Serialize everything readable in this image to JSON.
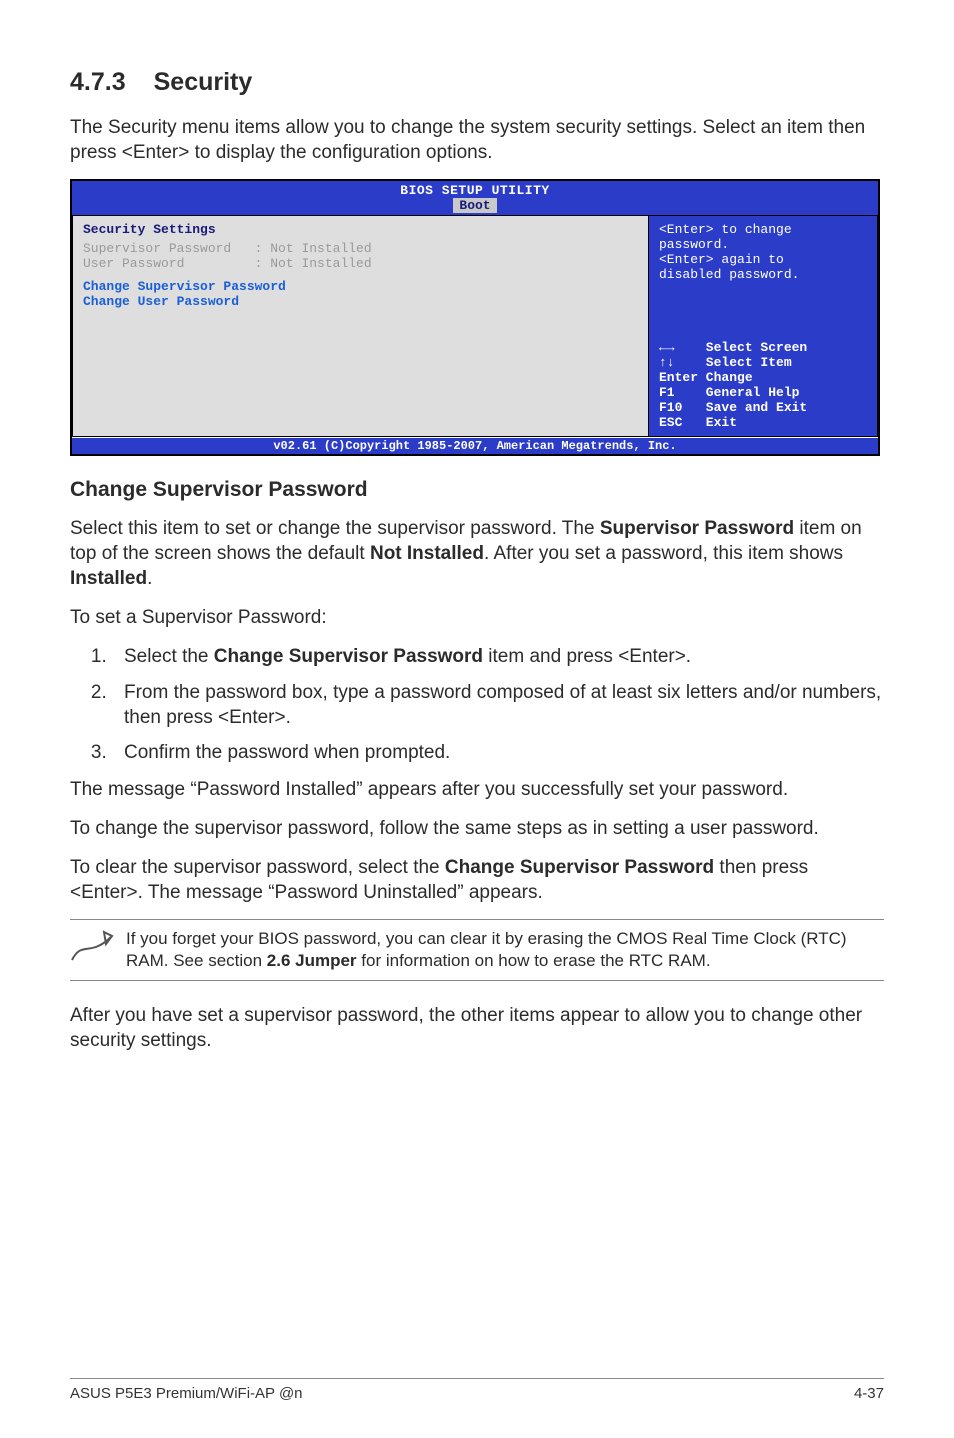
{
  "section": {
    "number": "4.7.3",
    "title": "Security"
  },
  "intro": "The Security menu items allow you to change the system security settings. Select an item then press <Enter> to display the configuration options.",
  "bios": {
    "title": "BIOS SETUP UTILITY",
    "tab": "Boot",
    "left": {
      "header": "Security Settings",
      "sup_label": "Supervisor Password",
      "sup_value": ": Not Installed",
      "user_label": "User Password",
      "user_value": ": Not Installed",
      "link1": "Change Supervisor Password",
      "link2": "Change User Password"
    },
    "right": {
      "desc1": "<Enter> to change",
      "desc2": "password.",
      "desc3": "<Enter> again to",
      "desc4": "disabled password.",
      "nav1": "←→    Select Screen",
      "nav2": "↑↓    Select Item",
      "nav3": "Enter Change",
      "nav4": "F1    General Help",
      "nav5": "F10   Save and Exit",
      "nav6": "ESC   Exit"
    },
    "footer": "v02.61 (C)Copyright 1985-2007, American Megatrends, Inc."
  },
  "sub_heading": "Change Supervisor Password",
  "para1a": "Select this item to set or change the supervisor password. The ",
  "para1b": "Supervisor Password",
  "para1c": " item on top of the screen shows the default ",
  "para1d": "Not Installed",
  "para1e": ". After you set a password, this item shows ",
  "para1f": "Installed",
  "para1g": ".",
  "para2": "To set a Supervisor Password:",
  "steps": {
    "s1a": "Select the ",
    "s1b": "Change Supervisor Password",
    "s1c": " item and press <Enter>.",
    "s2": "From the password box, type a password composed of at least six letters and/or numbers, then press <Enter>.",
    "s3": "Confirm the password when prompted."
  },
  "para3": "The message “Password Installed” appears after you successfully set your password.",
  "para4": "To change the supervisor password, follow the same steps as in setting a user password.",
  "para5a": "To clear the supervisor password, select the ",
  "para5b": "Change Supervisor Password",
  "para5c": " then press <Enter>. The message “Password Uninstalled” appears.",
  "note_a": "If you forget your BIOS password, you can clear it by erasing the CMOS Real Time Clock (RTC) RAM. See section ",
  "note_b": "2.6 Jumper",
  "note_c": " for information on how to erase the RTC RAM.",
  "para6": "After you have set a supervisor password, the other items appear to allow you to change other security settings.",
  "footer_left": "ASUS P5E3 Premium/WiFi-AP @n",
  "footer_right": "4-37"
}
